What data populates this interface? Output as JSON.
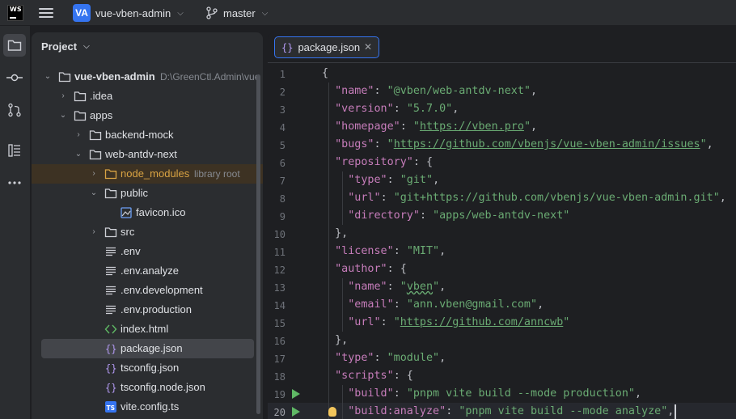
{
  "titlebar": {
    "logo_text": "WS",
    "project_badge": "VA",
    "project_name": "vue-vben-admin",
    "branch": "master"
  },
  "project_panel": {
    "title": "Project",
    "tree": [
      {
        "label": "vue-vben-admin",
        "hint": "D:\\GreenCtl.Admin\\vue",
        "type": "folder",
        "expanded": true,
        "level": 0,
        "bold": true
      },
      {
        "label": ".idea",
        "type": "folder",
        "expanded": false,
        "level": 1
      },
      {
        "label": "apps",
        "type": "folder",
        "expanded": true,
        "level": 1
      },
      {
        "label": "backend-mock",
        "type": "folder",
        "expanded": false,
        "level": 2
      },
      {
        "label": "web-antdv-next",
        "type": "folder",
        "expanded": true,
        "level": 2
      },
      {
        "label": "node_modules",
        "hint": "library root",
        "type": "folder-excluded",
        "expanded": false,
        "level": 3
      },
      {
        "label": "public",
        "type": "folder",
        "expanded": true,
        "level": 3
      },
      {
        "label": "favicon.ico",
        "type": "image",
        "level": 4
      },
      {
        "label": "src",
        "type": "folder",
        "expanded": false,
        "level": 3
      },
      {
        "label": ".env",
        "type": "text",
        "level": 3
      },
      {
        "label": ".env.analyze",
        "type": "text",
        "level": 3
      },
      {
        "label": ".env.development",
        "type": "text",
        "level": 3
      },
      {
        "label": ".env.production",
        "type": "text",
        "level": 3
      },
      {
        "label": "index.html",
        "type": "html",
        "level": 3
      },
      {
        "label": "package.json",
        "type": "json",
        "level": 3,
        "selected": true
      },
      {
        "label": "tsconfig.json",
        "type": "json",
        "level": 3
      },
      {
        "label": "tsconfig.node.json",
        "type": "json",
        "level": 3
      },
      {
        "label": "vite.config.ts",
        "type": "ts",
        "level": 3
      }
    ]
  },
  "editor": {
    "tab_label": "package.json",
    "tab_icon": "{}",
    "current_line": 20,
    "lines": [
      {
        "n": "1",
        "t": [
          [
            "p",
            "{"
          ]
        ]
      },
      {
        "n": "2",
        "t": [
          [
            "p",
            "  "
          ],
          [
            "k",
            "\"name\""
          ],
          [
            "p",
            ": "
          ],
          [
            "s",
            "\"@vben/web-antdv-next\""
          ],
          [
            "p",
            ","
          ]
        ]
      },
      {
        "n": "3",
        "t": [
          [
            "p",
            "  "
          ],
          [
            "k",
            "\"version\""
          ],
          [
            "p",
            ": "
          ],
          [
            "s",
            "\"5.7.0\""
          ],
          [
            "p",
            ","
          ]
        ]
      },
      {
        "n": "4",
        "t": [
          [
            "p",
            "  "
          ],
          [
            "k",
            "\"homepage\""
          ],
          [
            "p",
            ": "
          ],
          [
            "s",
            "\""
          ],
          [
            "u",
            "https://vben.pro"
          ],
          [
            "s",
            "\""
          ],
          [
            "p",
            ","
          ]
        ]
      },
      {
        "n": "5",
        "t": [
          [
            "p",
            "  "
          ],
          [
            "k",
            "\"bugs\""
          ],
          [
            "p",
            ": "
          ],
          [
            "s",
            "\""
          ],
          [
            "u",
            "https://github.com/vbenjs/vue-vben-admin/issues"
          ],
          [
            "s",
            "\""
          ],
          [
            "p",
            ","
          ]
        ]
      },
      {
        "n": "6",
        "t": [
          [
            "p",
            "  "
          ],
          [
            "k",
            "\"repository\""
          ],
          [
            "p",
            ": {"
          ]
        ]
      },
      {
        "n": "7",
        "t": [
          [
            "p",
            "    "
          ],
          [
            "k",
            "\"type\""
          ],
          [
            "p",
            ": "
          ],
          [
            "s",
            "\"git\""
          ],
          [
            "p",
            ","
          ]
        ]
      },
      {
        "n": "8",
        "t": [
          [
            "p",
            "    "
          ],
          [
            "k",
            "\"url\""
          ],
          [
            "p",
            ": "
          ],
          [
            "s",
            "\"git+https://github.com/vbenjs/vue-vben-admin.git\""
          ],
          [
            "p",
            ","
          ]
        ]
      },
      {
        "n": "9",
        "t": [
          [
            "p",
            "    "
          ],
          [
            "k",
            "\"directory\""
          ],
          [
            "p",
            ": "
          ],
          [
            "s",
            "\"apps/web-antdv-next\""
          ]
        ]
      },
      {
        "n": "10",
        "t": [
          [
            "p",
            "  },"
          ]
        ]
      },
      {
        "n": "11",
        "t": [
          [
            "p",
            "  "
          ],
          [
            "k",
            "\"license\""
          ],
          [
            "p",
            ": "
          ],
          [
            "s",
            "\"MIT\""
          ],
          [
            "p",
            ","
          ]
        ]
      },
      {
        "n": "12",
        "t": [
          [
            "p",
            "  "
          ],
          [
            "k",
            "\"author\""
          ],
          [
            "p",
            ": {"
          ]
        ]
      },
      {
        "n": "13",
        "t": [
          [
            "p",
            "    "
          ],
          [
            "k",
            "\"name\""
          ],
          [
            "p",
            ": "
          ],
          [
            "s",
            "\""
          ],
          [
            "w",
            "vben"
          ],
          [
            "s",
            "\""
          ],
          [
            "p",
            ","
          ]
        ]
      },
      {
        "n": "14",
        "t": [
          [
            "p",
            "    "
          ],
          [
            "k",
            "\"email\""
          ],
          [
            "p",
            ": "
          ],
          [
            "s",
            "\"ann.vben@gmail.com\""
          ],
          [
            "p",
            ","
          ]
        ]
      },
      {
        "n": "15",
        "t": [
          [
            "p",
            "    "
          ],
          [
            "k",
            "\"url\""
          ],
          [
            "p",
            ": "
          ],
          [
            "s",
            "\""
          ],
          [
            "u",
            "https://github.com/anncwb"
          ],
          [
            "s",
            "\""
          ]
        ]
      },
      {
        "n": "16",
        "t": [
          [
            "p",
            "  },"
          ]
        ]
      },
      {
        "n": "17",
        "t": [
          [
            "p",
            "  "
          ],
          [
            "k",
            "\"type\""
          ],
          [
            "p",
            ": "
          ],
          [
            "s",
            "\"module\""
          ],
          [
            "p",
            ","
          ]
        ]
      },
      {
        "n": "18",
        "t": [
          [
            "p",
            "  "
          ],
          [
            "k",
            "\"scripts\""
          ],
          [
            "p",
            ": {"
          ]
        ]
      },
      {
        "n": "19",
        "t": [
          [
            "p",
            "    "
          ],
          [
            "k",
            "\"build\""
          ],
          [
            "p",
            ": "
          ],
          [
            "s",
            "\"pnpm vite build --mode production\""
          ],
          [
            "p",
            ","
          ]
        ]
      },
      {
        "n": "20",
        "t": [
          [
            "p",
            "    "
          ],
          [
            "k",
            "\"build:analyze\""
          ],
          [
            "p",
            ": "
          ],
          [
            "s",
            "\"pnpm vite build --mode analyze\""
          ],
          [
            "p",
            ","
          ]
        ]
      }
    ],
    "run_lines": [
      19,
      20
    ],
    "bulb_line": 20
  }
}
